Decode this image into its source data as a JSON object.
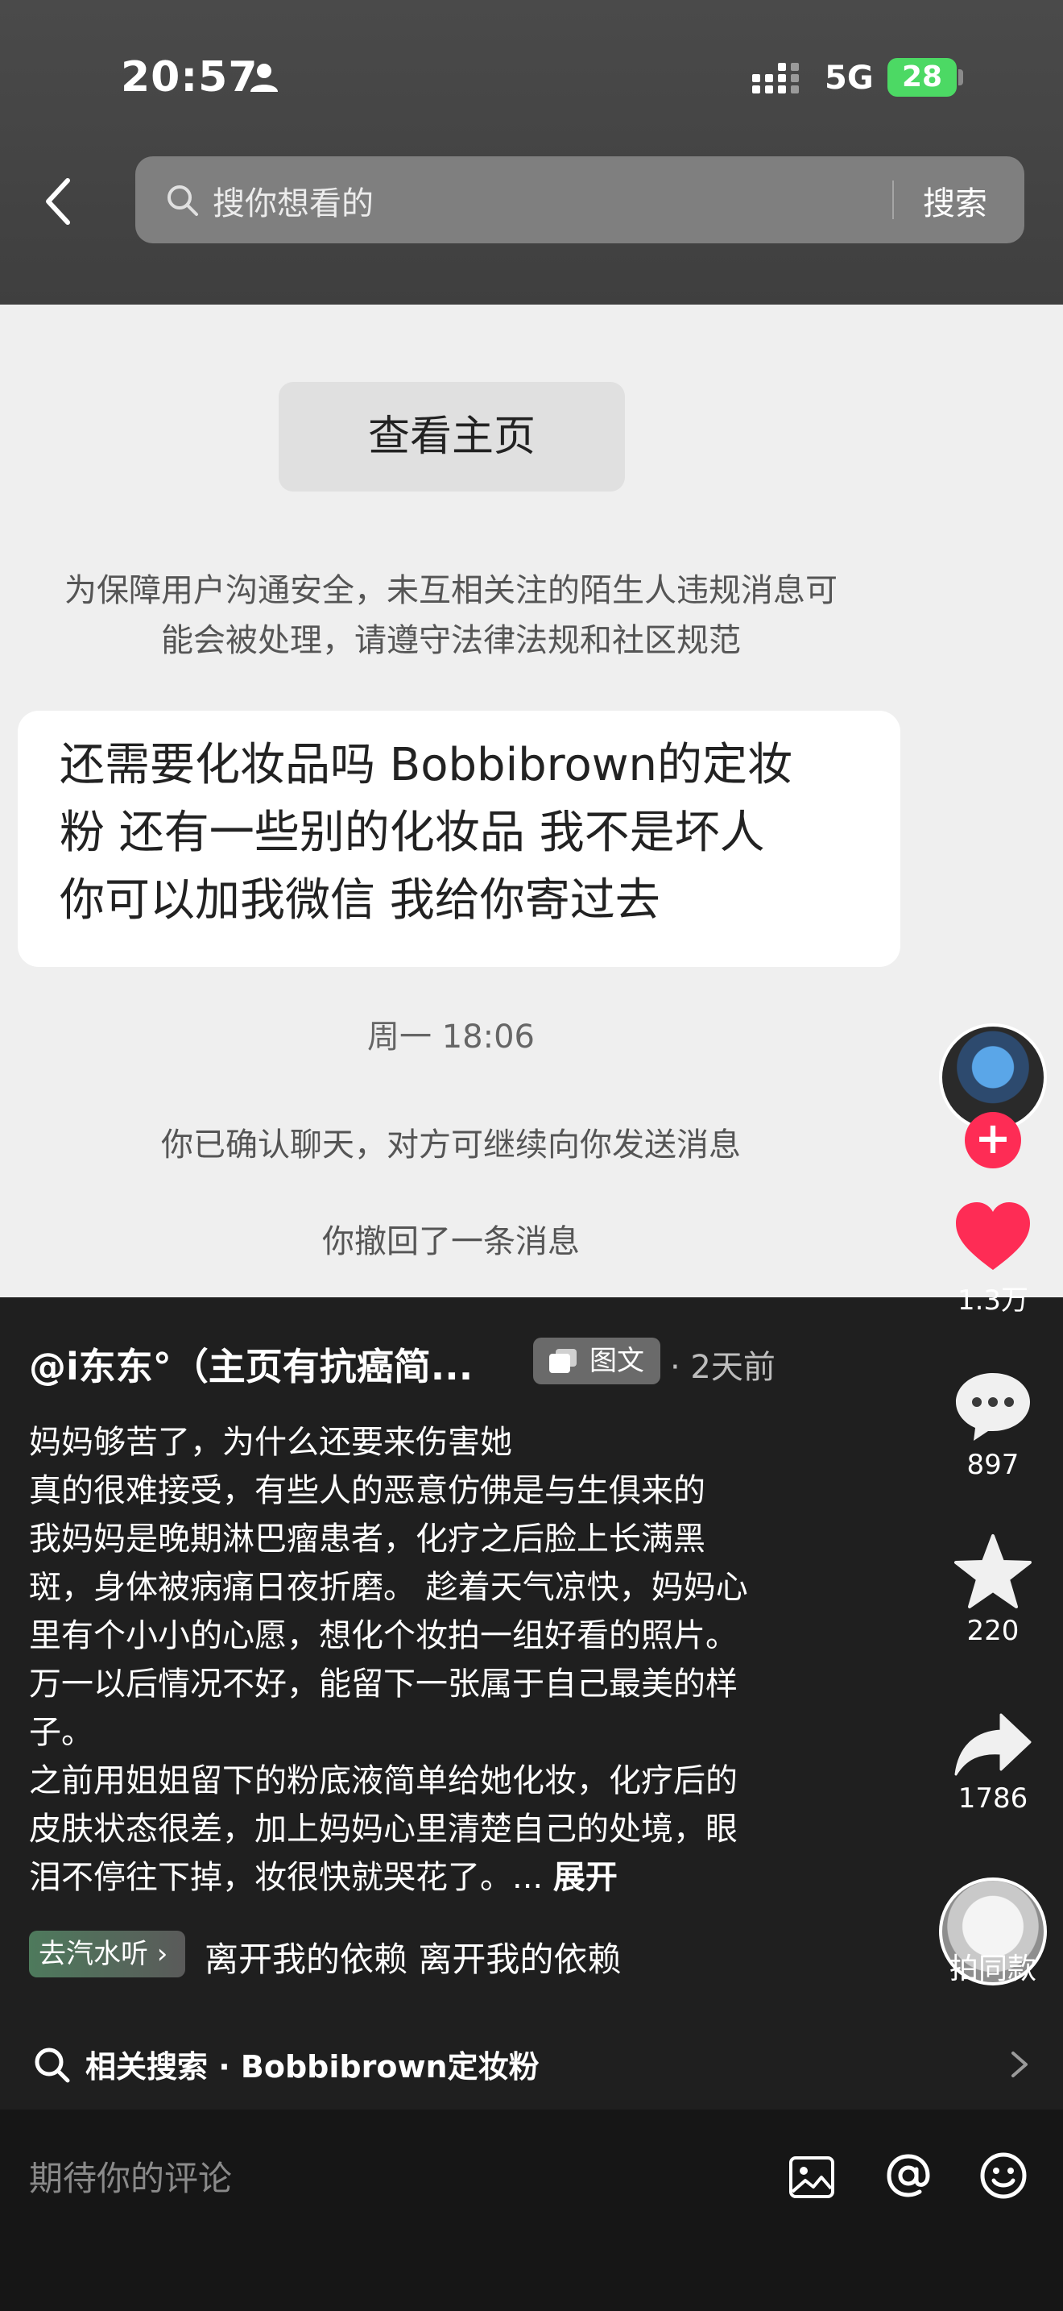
{
  "status_bar": {
    "time": "20:57",
    "network": "5G",
    "battery": "28"
  },
  "search": {
    "placeholder": "搜你想看的",
    "button": "搜索"
  },
  "post_image": {
    "view_home": "查看主页",
    "notice_line1": "为保障用户沟通安全，未互相关注的陌生人违规消息可",
    "notice_line2": "能会被处理，请遵守法律法规和社区规范",
    "message_line1": "还需要化妆品吗 Bobbibrown的定妆",
    "message_line2": "粉 还有一些别的化妆品 我不是坏人",
    "message_line3": "你可以加我微信 我给你寄过去",
    "message_time": "周一 18:06",
    "confirm_notice": "你已确认聊天，对方可继续向你发送消息",
    "recall_notice": "你撤回了一条消息"
  },
  "actions": {
    "likes": "1.3万",
    "comments": "897",
    "favorites": "220",
    "shares": "1786",
    "same_style": "拍同款"
  },
  "post": {
    "author": "@i东东°（主页有抗癌简...",
    "type_tag": "图文",
    "time": "· 2天前",
    "caption_lines": [
      "妈妈够苦了，为什么还要来伤害她",
      "真的很难接受，有些人的恶意仿佛是与生俱来的",
      "我妈妈是晚期淋巴瘤患者，化疗之后脸上长满黑",
      "斑，身体被病痛日夜折磨。 趁着天气凉快，妈妈心",
      "里有个小小的心愿，想化个妆拍一组好看的照片。",
      "万一以后情况不好，能留下一张属于自己最美的样",
      "子。",
      "之前用姐姐留下的粉底液简单给她化妆，化疗后的",
      "皮肤状态很差，加上妈妈心里清楚自己的处境，眼",
      "泪不停往下掉，妆很快就哭花了。... "
    ],
    "expand": "展开",
    "music_tag": "去汽水听 ›",
    "music_title": "离开我的依赖    离开我的依赖"
  },
  "related_search": {
    "label": "相关搜索 · Bobbibrown定妆粉"
  },
  "comment_bar": {
    "placeholder": "期待你的评论"
  },
  "colors": {
    "like_red": "#fe2c55",
    "battery_green": "#4cd964",
    "background": "#1f1f1f"
  },
  "icons": [
    "person-icon",
    "signal-icon",
    "back-icon",
    "search-icon",
    "heart-icon",
    "comment-icon",
    "star-icon",
    "share-icon",
    "image-icon",
    "at-icon",
    "emoji-icon",
    "chevron-right-icon"
  ]
}
